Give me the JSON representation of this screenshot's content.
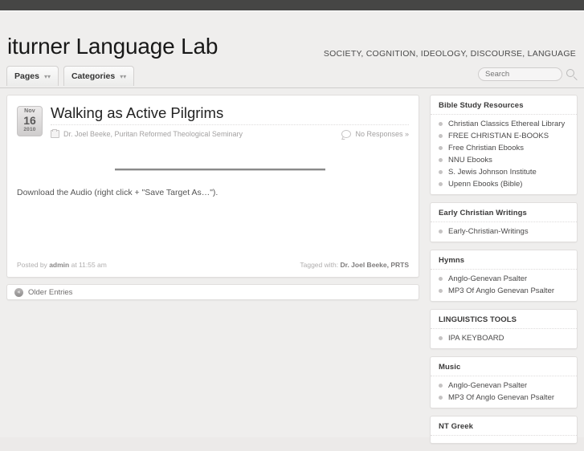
{
  "site": {
    "title": "iturner Language Lab",
    "tagline": "SOCIETY, COGNITION, IDEOLOGY, DISCOURSE, LANGUAGE"
  },
  "nav": {
    "tabs": [
      {
        "label": "Pages",
        "caret": "chevron-down-icon"
      },
      {
        "label": "Categories",
        "caret": "chevron-down-icon"
      }
    ]
  },
  "search": {
    "placeholder": "Search",
    "value": "",
    "icon": "search-icon"
  },
  "post": {
    "date": {
      "month": "Nov",
      "day": "16",
      "year": "2010"
    },
    "title": "Walking as Active Pilgrims",
    "category": "Dr. Joel Beeke, Puritan Reformed Theological Seminary",
    "responses": "No Responses »",
    "body_text": "Download the Audio (right click + \"Save Target As…\").",
    "footer_prefix": "Posted by",
    "footer_author": "admin",
    "footer_time": "at 11:55 am",
    "tagged_label": "Tagged with:",
    "tagged_value": "Dr. Joel Beeke, PRTS"
  },
  "pagination": {
    "older_label": "Older Entries",
    "older_icon": "«"
  },
  "sidebar": {
    "widgets": [
      {
        "title": "Bible Study Resources",
        "items": [
          "Christian Classics Ethereal Library",
          "FREE CHRISTIAN E-BOOKS",
          "Free Christian Ebooks",
          "NNU Ebooks",
          "S. Jewis Johnson Institute",
          "Upenn Ebooks (Bible)"
        ]
      },
      {
        "title": "Early Christian Writings",
        "items": [
          "Early-Christian-Writings"
        ]
      },
      {
        "title": "Hymns",
        "items": [
          "Anglo-Genevan Psalter",
          "MP3 Of Anglo Genevan Psalter"
        ]
      },
      {
        "title": "LINGUISTICS TOOLS",
        "items": [
          "IPA KEYBOARD"
        ]
      },
      {
        "title": "Music",
        "items": [
          "Anglo-Genevan Psalter",
          "MP3 Of Anglo Genevan Psalter"
        ]
      },
      {
        "title": "NT Greek",
        "items": []
      }
    ]
  },
  "colors": {
    "page_bg": "#efeeed",
    "topbar": "#464645",
    "card_bg": "#ffffff",
    "card_border": "#e0dedd"
  }
}
